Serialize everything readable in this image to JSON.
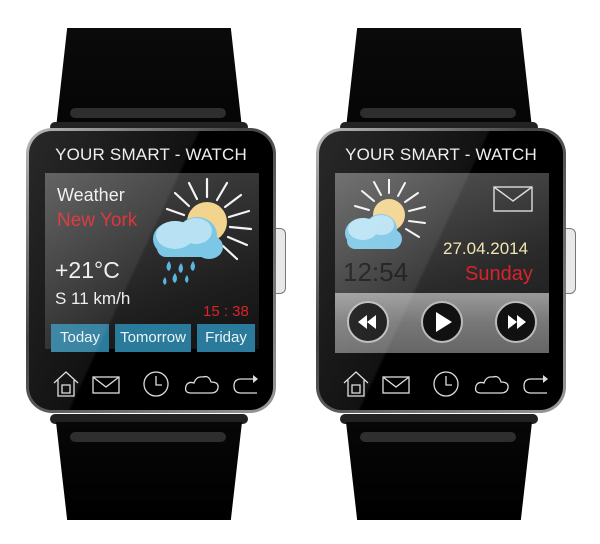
{
  "watches": [
    {
      "title": "YOUR SMART - WATCH",
      "weather": {
        "label": "Weather",
        "city": "New York",
        "temperature": "+21°C",
        "wind": "S 11 km/h",
        "time": "15 : 38",
        "condition_icon": "sun-cloud-rain-icon"
      },
      "day_buttons": [
        "Today",
        "Tomorrow",
        "Friday"
      ],
      "nav_icons": [
        "home-icon",
        "mail-icon",
        "clock-icon",
        "cloud-icon",
        "forward-icon"
      ]
    },
    {
      "title": "YOUR SMART - WATCH",
      "clock": {
        "time": "12:54",
        "date": "27.04.2014",
        "weekday": "Sunday",
        "condition_icon": "sun-cloud-icon",
        "notification_icon": "mail-icon"
      },
      "media_controls": [
        "rewind-icon",
        "play-icon",
        "fast-forward-icon"
      ],
      "nav_icons": [
        "home-icon",
        "mail-icon",
        "clock-icon",
        "cloud-icon",
        "forward-icon"
      ]
    }
  ],
  "colors": {
    "accent_red": "#d9232a",
    "date_cream": "#f1e7b2",
    "button_blue": "#2a7b9b"
  }
}
